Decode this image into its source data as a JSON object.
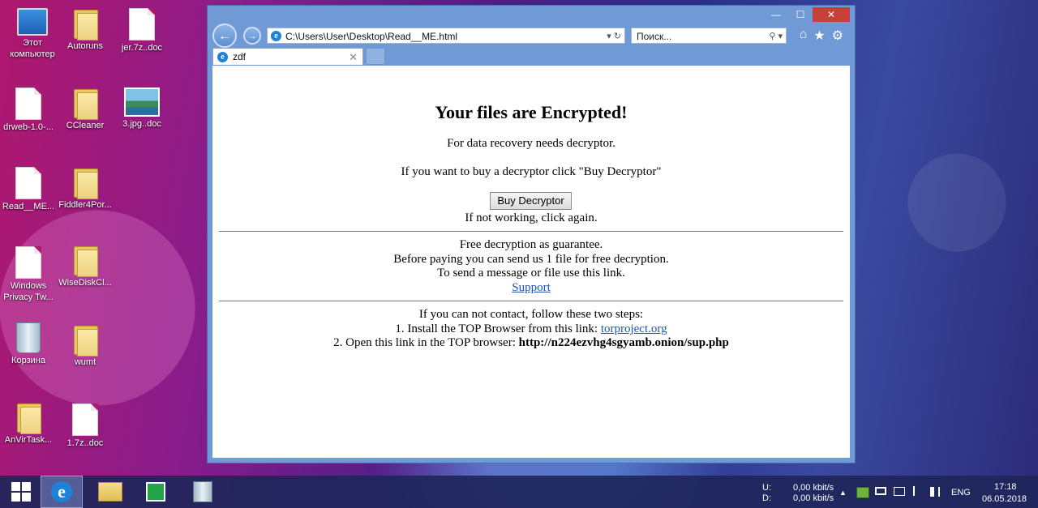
{
  "desktop": {
    "icons": [
      {
        "label": "Этот компьютер",
        "type": "computer"
      },
      {
        "label": "Autoruns",
        "type": "folder"
      },
      {
        "label": "jer.7z..doc",
        "type": "doc"
      },
      {
        "label": "drweb-1.0-...",
        "type": "doc"
      },
      {
        "label": "CCleaner",
        "type": "folder"
      },
      {
        "label": "3.jpg..doc",
        "type": "image"
      },
      {
        "label": "Read__ME...",
        "type": "doc"
      },
      {
        "label": "Fiddler4Por...",
        "type": "folder"
      },
      {
        "label": "Windows Privacy Tw...",
        "type": "doc"
      },
      {
        "label": "WiseDiskCl...",
        "type": "folder"
      },
      {
        "label": "Корзина",
        "type": "recycle-bin"
      },
      {
        "label": "wumt",
        "type": "folder"
      },
      {
        "label": "AnVirTask...",
        "type": "folder"
      },
      {
        "label": "1.7z..doc",
        "type": "doc"
      }
    ]
  },
  "browser": {
    "window_controls": {
      "minimize": "—",
      "maximize": "☐",
      "close": "✕"
    },
    "back_icon": "←",
    "forward_icon": "→",
    "address": "C:\\Users\\User\\Desktop\\Read__ME.html",
    "address_controls": "▾ ↻",
    "search_placeholder": "Поиск...",
    "search_controls": "⚲ ▾",
    "toolbar_icons": {
      "home": "⌂",
      "favorites": "★",
      "settings": "⚙"
    },
    "tab": {
      "title": "zdf",
      "close": "✕"
    }
  },
  "page": {
    "heading": "Your files are Encrypted!",
    "line1": "For data recovery needs decryptor.",
    "line2": "If you want to buy a decryptor click \"Buy Decryptor\"",
    "buy_button": "Buy Decryptor",
    "line3": "If not working, click again.",
    "guarantee1": "Free decryption as guarantee.",
    "guarantee2": "Before paying you can send us 1 file for free decryption.",
    "guarantee3": "To send a message or file use this link.",
    "support_link": "Support",
    "steps_intro": "If you can not contact, follow these two steps:",
    "step1_text": "1. Install the TOP Browser from this link: ",
    "step1_link": "torproject.org",
    "step2_text": "2. Open this link in the TOP browser: ",
    "step2_url": "http://n224ezvhg4sgyamb.onion/sup.php"
  },
  "taskbar": {
    "network_labels": {
      "u": "U:",
      "d": "D:"
    },
    "upload_speed": "0,00 kbit/s",
    "download_speed": "0,00 kbit/s",
    "tray_chevron": "▲",
    "language": "ENG",
    "time": "17:18",
    "date": "06.05.2018"
  }
}
